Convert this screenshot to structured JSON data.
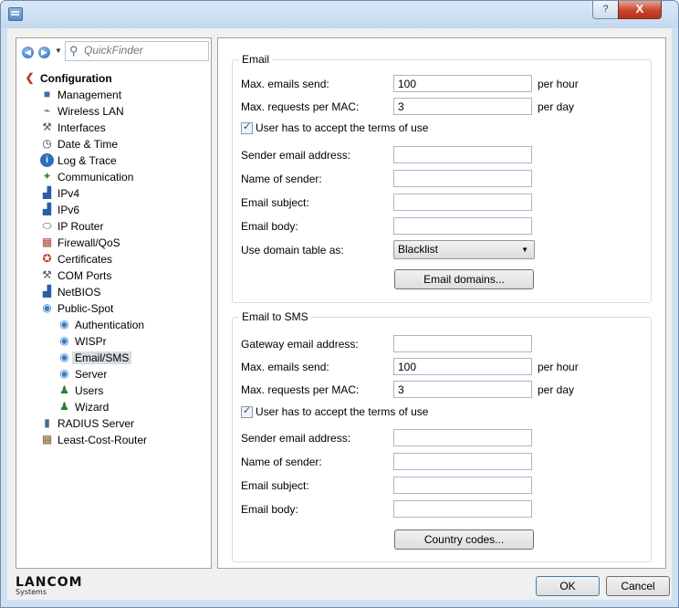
{
  "window": {
    "help_glyph": "?",
    "close_glyph": "X"
  },
  "navigator": {
    "quickfinder_placeholder": "QuickFinder",
    "tree": [
      {
        "label": "Configuration",
        "icon": "configuration-icon"
      },
      {
        "label": "Management",
        "icon": "management-icon"
      },
      {
        "label": "Wireless LAN",
        "icon": "wireless-lan-icon"
      },
      {
        "label": "Interfaces",
        "icon": "interfaces-icon"
      },
      {
        "label": "Date & Time",
        "icon": "clock-icon"
      },
      {
        "label": "Log & Trace",
        "icon": "info-icon"
      },
      {
        "label": "Communication",
        "icon": "communication-icon"
      },
      {
        "label": "IPv4",
        "icon": "network-icon"
      },
      {
        "label": "IPv6",
        "icon": "network-icon"
      },
      {
        "label": "IP Router",
        "icon": "router-icon"
      },
      {
        "label": "Firewall/QoS",
        "icon": "firewall-icon"
      },
      {
        "label": "Certificates",
        "icon": "certificate-icon"
      },
      {
        "label": "COM Ports",
        "icon": "com-ports-icon"
      },
      {
        "label": "NetBIOS",
        "icon": "network-icon"
      },
      {
        "label": "Public-Spot",
        "icon": "public-spot-icon"
      },
      {
        "label": "Authentication",
        "icon": "public-spot-icon"
      },
      {
        "label": "WISPr",
        "icon": "public-spot-icon"
      },
      {
        "label": "Email/SMS",
        "icon": "public-spot-icon"
      },
      {
        "label": "Server",
        "icon": "public-spot-icon"
      },
      {
        "label": "Users",
        "icon": "users-icon"
      },
      {
        "label": "Wizard",
        "icon": "wizard-icon"
      },
      {
        "label": "RADIUS Server",
        "icon": "radius-server-icon"
      },
      {
        "label": "Least-Cost-Router",
        "icon": "least-cost-router-icon"
      }
    ]
  },
  "email": {
    "title": "Email",
    "max_emails_label": "Max. emails send:",
    "max_emails_value": "100",
    "max_emails_unit": "per hour",
    "max_requests_label": "Max. requests per MAC:",
    "max_requests_value": "3",
    "max_requests_unit": "per day",
    "terms_label": "User has to accept the terms of use",
    "terms_checked": true,
    "sender_address_label": "Sender email address:",
    "sender_name_label": "Name of sender:",
    "subject_label": "Email subject:",
    "body_label": "Email body:",
    "domain_table_label": "Use domain table as:",
    "domain_table_value": "Blacklist",
    "domains_button": "Email domains..."
  },
  "email_to_sms": {
    "title": "Email to SMS",
    "gateway_label": "Gateway email address:",
    "max_emails_label": "Max. emails send:",
    "max_emails_value": "100",
    "max_emails_unit": "per hour",
    "max_requests_label": "Max. requests per MAC:",
    "max_requests_value": "3",
    "max_requests_unit": "per day",
    "terms_label": "User has to accept the terms of use",
    "terms_checked": true,
    "sender_address_label": "Sender email address:",
    "sender_name_label": "Name of sender:",
    "subject_label": "Email subject:",
    "body_label": "Email body:",
    "country_codes_button": "Country codes..."
  },
  "footer": {
    "logo_main": "LANCOM",
    "logo_sub": "Systems",
    "ok_button": "OK",
    "cancel_button": "Cancel"
  }
}
